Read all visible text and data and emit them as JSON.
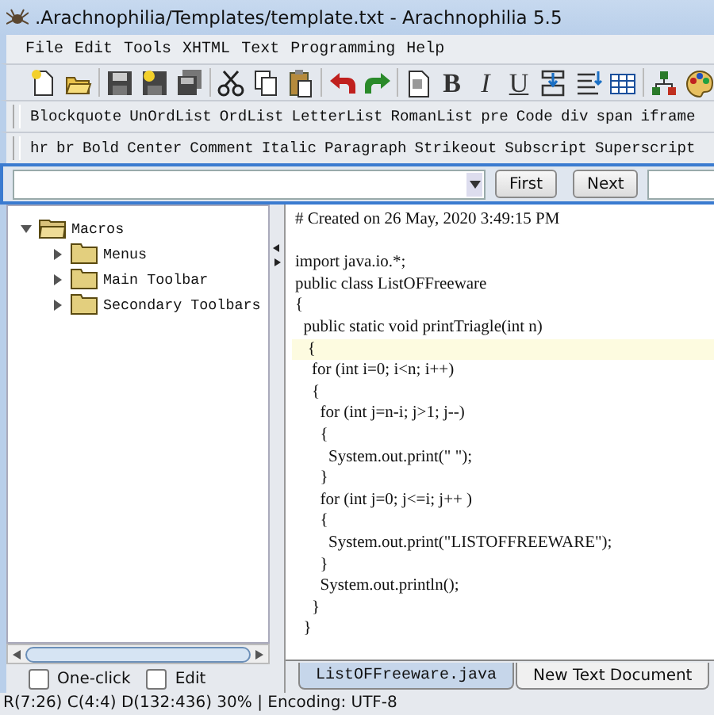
{
  "window": {
    "title": ".Arachnophilia/Templates/template.txt - Arachnophilia 5.5"
  },
  "menu": [
    "File",
    "Edit",
    "Tools",
    "XHTML",
    "Text",
    "Programming",
    "Help"
  ],
  "toolbar": [
    {
      "kind": "new"
    },
    {
      "kind": "open"
    },
    {
      "kind": "save"
    },
    {
      "kind": "saveas"
    },
    {
      "kind": "saveall"
    },
    {
      "kind": "cut"
    },
    {
      "kind": "copy"
    },
    {
      "kind": "paste"
    },
    {
      "kind": "undo"
    },
    {
      "kind": "redo"
    },
    {
      "kind": "doc"
    },
    {
      "kind": "bold",
      "text": "B"
    },
    {
      "kind": "italic",
      "text": "I"
    },
    {
      "kind": "underline",
      "text": "U"
    },
    {
      "kind": "insert"
    },
    {
      "kind": "insert2"
    },
    {
      "kind": "table"
    },
    {
      "kind": "tree"
    },
    {
      "kind": "palette"
    }
  ],
  "tag_toolbar_1": [
    "Blockquote",
    "UnOrdList",
    "OrdList",
    "LetterList",
    "RomanList",
    "pre",
    "Code",
    "div",
    "span",
    "iframe"
  ],
  "tag_toolbar_2": [
    "hr",
    "br",
    "Bold",
    "Center",
    "Comment",
    "Italic",
    "Paragraph",
    "Strikeout",
    "Subscript",
    "Superscript"
  ],
  "search": {
    "buttons": [
      "First",
      "Next"
    ]
  },
  "tree": [
    {
      "label": "Macros",
      "expanded": true,
      "children": [
        {
          "label": "Menus",
          "expanded": false
        },
        {
          "label": "Main Toolbar",
          "expanded": false
        },
        {
          "label": "Secondary Toolbars",
          "expanded": false
        }
      ]
    }
  ],
  "options": [
    {
      "label": "One-click",
      "checked": false
    },
    {
      "label": "Edit",
      "checked": false
    }
  ],
  "code": [
    {
      "text": "# Created on 26 May, 2020 3:49:15 PM",
      "highlighted": false
    },
    {
      "text": "import java.io.*;",
      "highlighted": false,
      "gap_before": true
    },
    {
      "text": "public class ListOFFreeware",
      "highlighted": false
    },
    {
      "text": "{",
      "highlighted": false
    },
    {
      "text": "  public static void printTriagle(int n)",
      "highlighted": false
    },
    {
      "text": "   {",
      "highlighted": true
    },
    {
      "text": "    for (int i=0; i<n; i++)",
      "highlighted": false
    },
    {
      "text": "    {",
      "highlighted": false
    },
    {
      "text": "      for (int j=n-i; j>1; j--)",
      "highlighted": false
    },
    {
      "text": "      {",
      "highlighted": false
    },
    {
      "text": "        System.out.print(\" \");",
      "highlighted": false
    },
    {
      "text": "      }",
      "highlighted": false
    },
    {
      "text": "      for (int j=0; j<=i; j++ )",
      "highlighted": false
    },
    {
      "text": "      {",
      "highlighted": false
    },
    {
      "text": "        System.out.print(\"LISTOFFREEWARE\");",
      "highlighted": false
    },
    {
      "text": "      }",
      "highlighted": false
    },
    {
      "text": "      System.out.println();",
      "highlighted": false
    },
    {
      "text": "    }",
      "highlighted": false
    },
    {
      "text": "  }",
      "highlighted": false
    }
  ],
  "tabs": [
    {
      "label": "ListOFFreeware.java",
      "selected": true
    },
    {
      "label": "New Text Document",
      "selected": false
    }
  ],
  "status_bar": "R(7:26) C(4:4) D(132:436) 30% | Encoding: UTF-8"
}
